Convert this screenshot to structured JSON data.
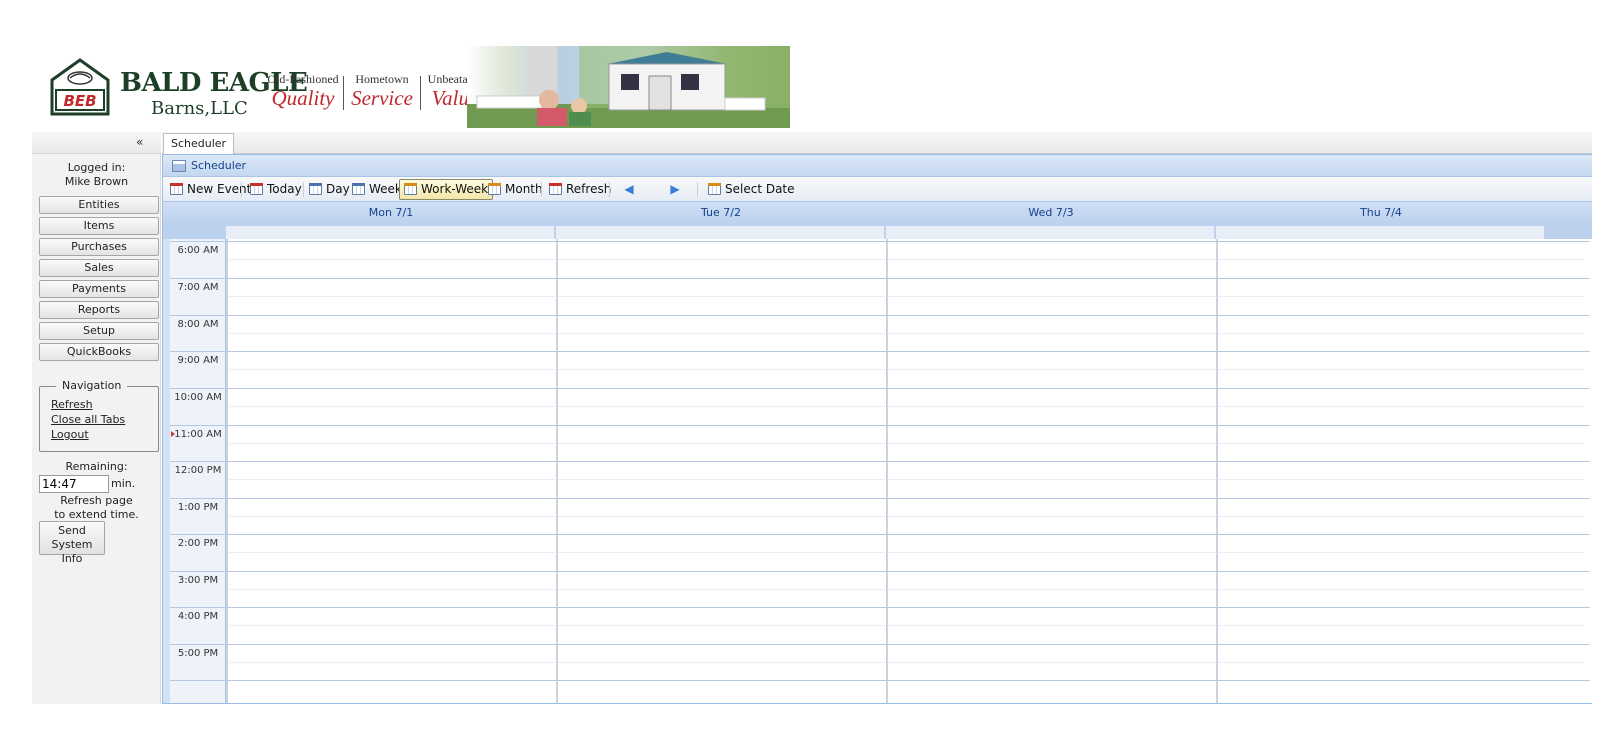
{
  "banner": {
    "logo_badge_text": "BEB",
    "logo_line1": "BALD EAGLE",
    "logo_line2": "Barns,LLC",
    "slogans": [
      {
        "small": "Old-Fashioned",
        "big": "Quality"
      },
      {
        "small": "Hometown",
        "big": "Service"
      },
      {
        "small": "Unbeatable",
        "big": "Value"
      }
    ]
  },
  "sidebar": {
    "collapse_glyph": "«",
    "logged_in_label": "Logged in:",
    "user_name": "Mike Brown",
    "buttons": [
      "Entities",
      "Items",
      "Purchases",
      "Sales",
      "Payments",
      "Reports",
      "Setup",
      "QuickBooks"
    ],
    "navigation": {
      "legend": "Navigation",
      "links": [
        "Refresh",
        "Close all Tabs",
        "Logout"
      ]
    },
    "remaining_label": "Remaining:",
    "remaining_value": "14:47",
    "remaining_unit": "min.",
    "refresh_hint_1": "Refresh page",
    "refresh_hint_2": "to extend time.",
    "send_info_1": "Send",
    "send_info_2": "System Info"
  },
  "tabs": [
    {
      "label": "Scheduler",
      "active": true
    }
  ],
  "panel": {
    "title": "Scheduler",
    "toolbar": {
      "new_event": "New Event",
      "today": "Today",
      "day": "Day",
      "week": "Week",
      "work_week": "Work-Week",
      "month": "Month",
      "refresh": "Refresh",
      "prev_icon": "arrow-left-icon",
      "next_icon": "arrow-right-icon",
      "select_date": "Select Date",
      "active_view": "Work-Week"
    }
  },
  "calendar": {
    "days": [
      "Mon 7/1",
      "Tue 7/2",
      "Wed 7/3",
      "Thu 7/4"
    ],
    "times": [
      "6:00 AM",
      "7:00 AM",
      "8:00 AM",
      "9:00 AM",
      "10:00 AM",
      "11:00 AM",
      "12:00 PM",
      "1:00 PM",
      "2:00 PM",
      "3:00 PM",
      "4:00 PM",
      "5:00 PM"
    ],
    "current_time_marker_row": "11:00 AM"
  },
  "colors": {
    "accent_blue": "#15428b",
    "header_blue": "#bcd1ee",
    "brand_green": "#1e3f27",
    "brand_red": "#c0282d",
    "now_marker": "#d0353b"
  }
}
